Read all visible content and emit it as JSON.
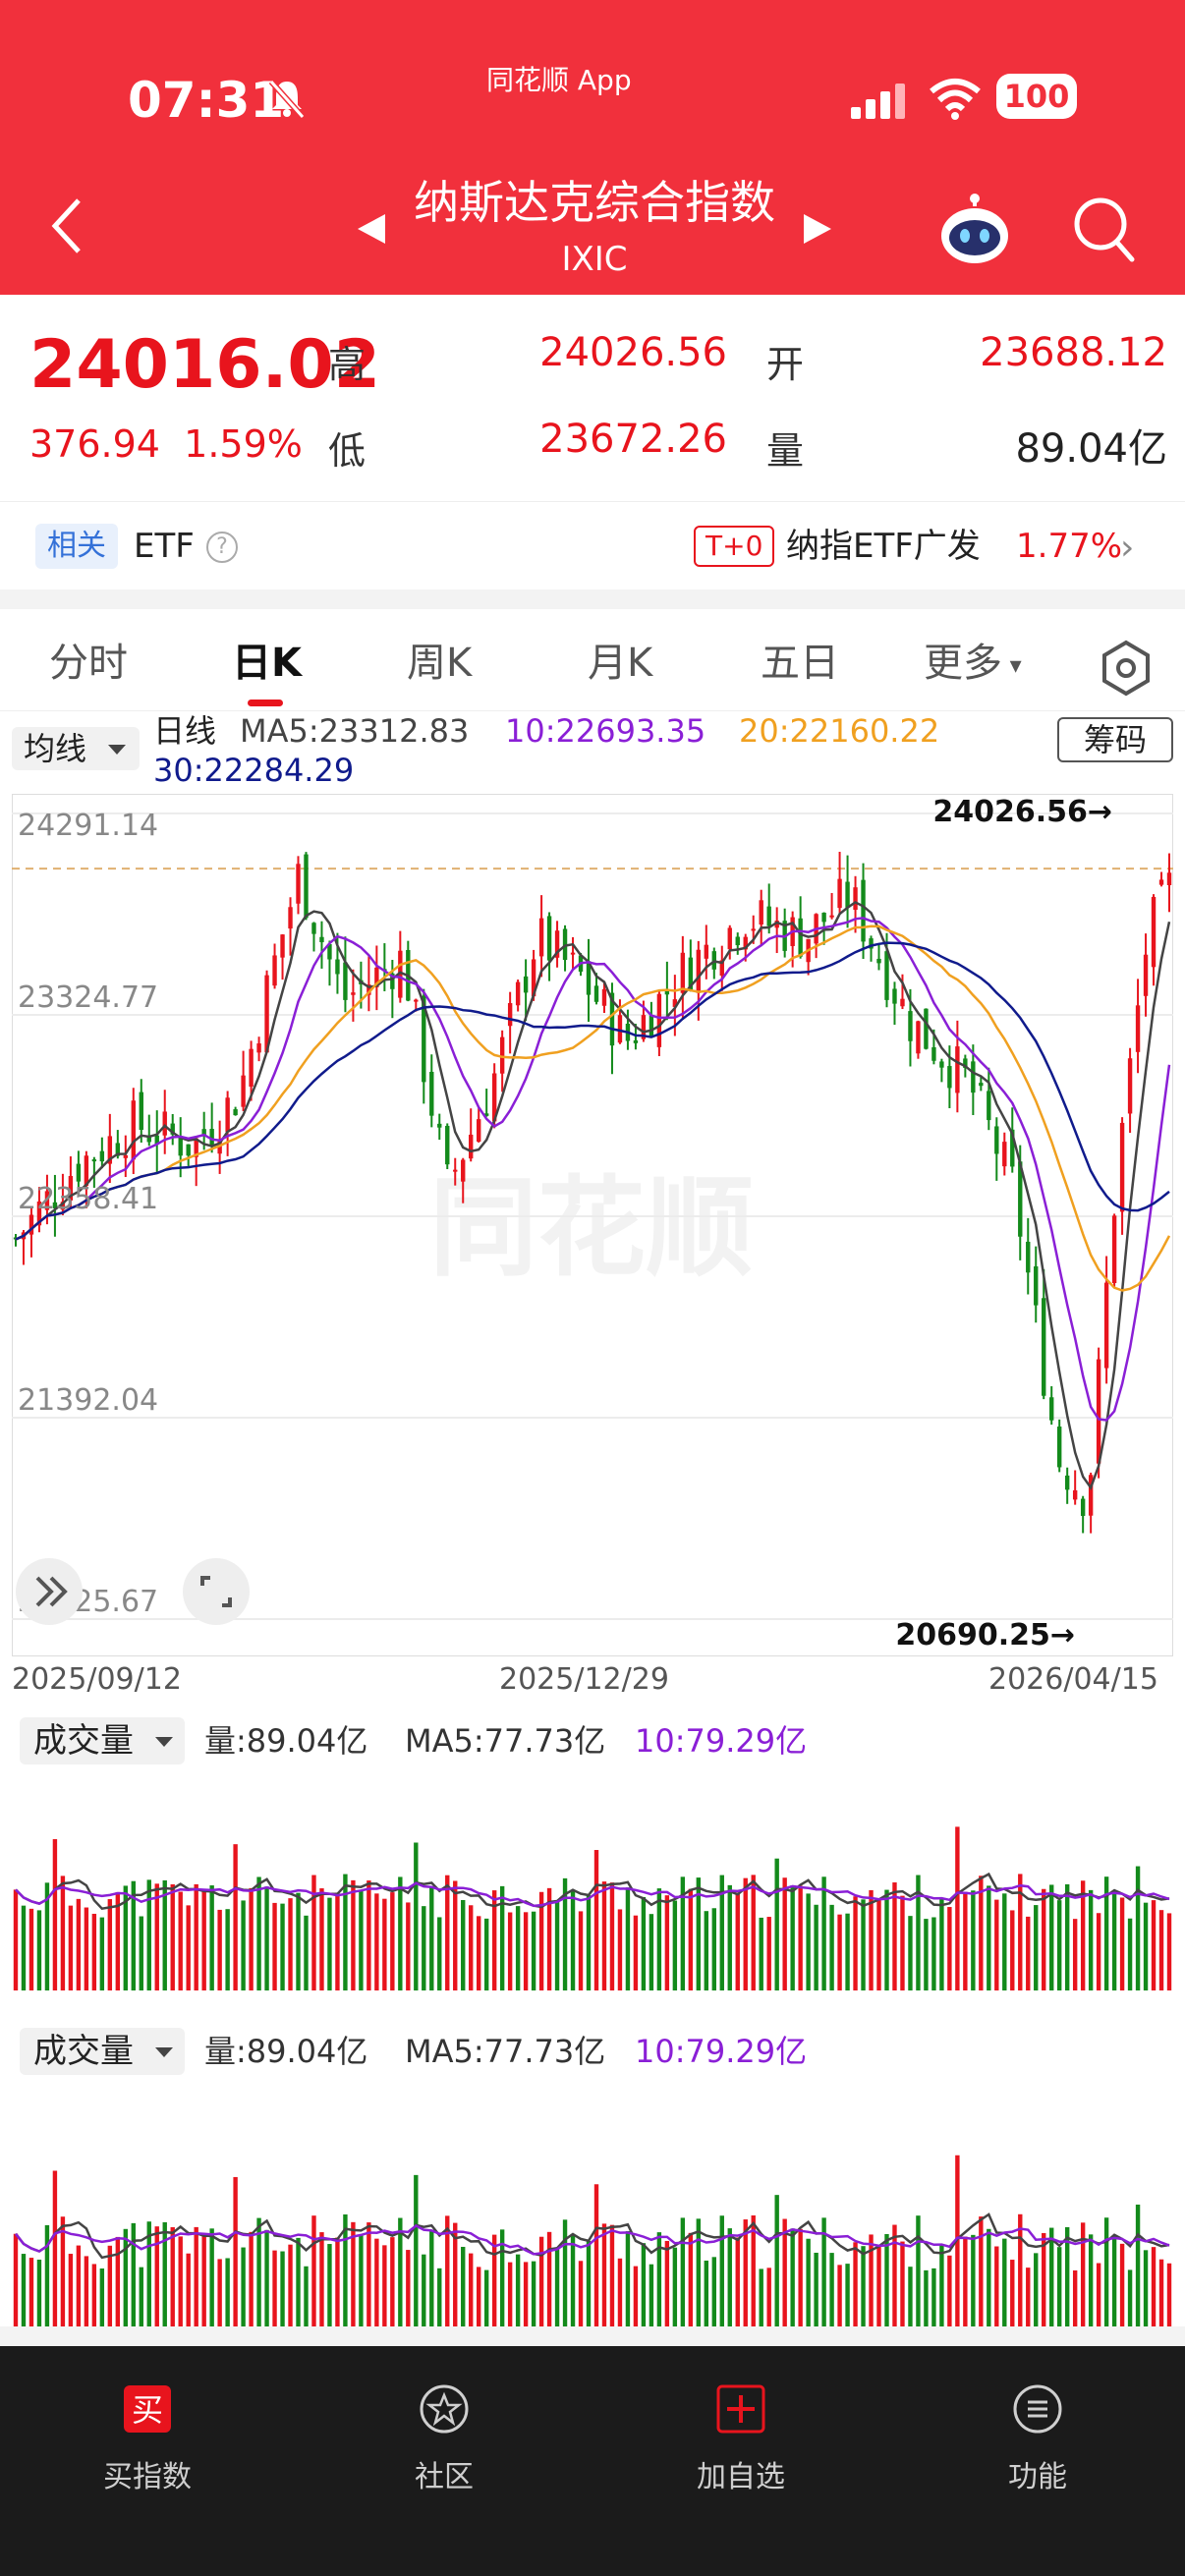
{
  "status": {
    "time": "07:31",
    "app": "同花顺 App",
    "battery": "100"
  },
  "header": {
    "title": "纳斯达克综合指数",
    "subtitle": "IXIC"
  },
  "quote": {
    "price": "24016.02",
    "change": "376.94",
    "change_pct": "1.59%",
    "high_label": "高",
    "high": "24026.56",
    "low_label": "低",
    "low": "23672.26",
    "open_label": "开",
    "open": "23688.12",
    "vol_label": "量",
    "volume": "89.04亿"
  },
  "etf": {
    "related": "相关",
    "etf_label": "ETF",
    "t0": "T+0",
    "name": "纳指ETF广发",
    "pct": "1.77%"
  },
  "tabs": [
    "分时",
    "日K",
    "周K",
    "月K",
    "五日",
    "更多"
  ],
  "ma": {
    "selector": "均线",
    "line_type": "日线",
    "ma5": "MA5:23312.83",
    "ma10": "10:22693.35",
    "ma20": "20:22160.22",
    "ma30": "30:22284.29",
    "chouma": "筹码"
  },
  "colors": {
    "up": "#e8141d",
    "down": "#138a1b",
    "ma5": "#444444",
    "ma10": "#8a1fd6",
    "ma20": "#f0a020",
    "ma30": "#101b8c"
  },
  "chart_data": {
    "type": "candlestick",
    "y_ticks": [
      "24291.14",
      "23324.77",
      "22358.41",
      "21392.04",
      "20425.67"
    ],
    "ylim": [
      20425.67,
      24291.14
    ],
    "x_ticks": [
      "2025/09/12",
      "2025/12/29",
      "2026/04/15"
    ],
    "high_marker": "24026.56→",
    "low_marker": "20690.25→",
    "watermark": "同花顺"
  },
  "volume": [
    {
      "selector": "成交量",
      "vol": "量:89.04亿",
      "ma5": "MA5:77.73亿",
      "ma10": "10:79.29亿"
    },
    {
      "selector": "成交量",
      "vol": "量:89.04亿",
      "ma5": "MA5:77.73亿",
      "ma10": "10:79.29亿"
    }
  ],
  "bottom_nav": [
    "买指数",
    "社区",
    "加自选",
    "功能"
  ]
}
